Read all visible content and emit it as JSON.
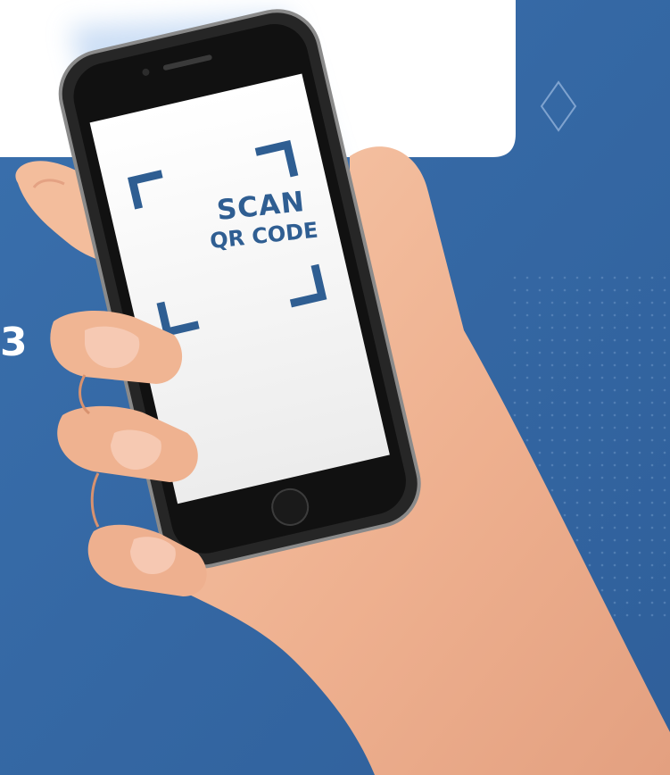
{
  "colors": {
    "background_blue": "#3468a6",
    "card_white": "#ffffff",
    "phone_body": "#1e1e1e",
    "screen_white": "#f4f4f4",
    "scan_frame": "#2f5e92",
    "skin": "#f1b796",
    "skin_shadow": "#d8926f",
    "nail": "#f7cdb8",
    "dots": "#5a86ba"
  },
  "step": {
    "number": "3"
  },
  "phone": {
    "scan_line1": "SCAN",
    "scan_line2": "QR CODE"
  },
  "icons": {
    "diamond": "diamond-outline-icon",
    "frame": "scan-frame-corners-icon"
  }
}
